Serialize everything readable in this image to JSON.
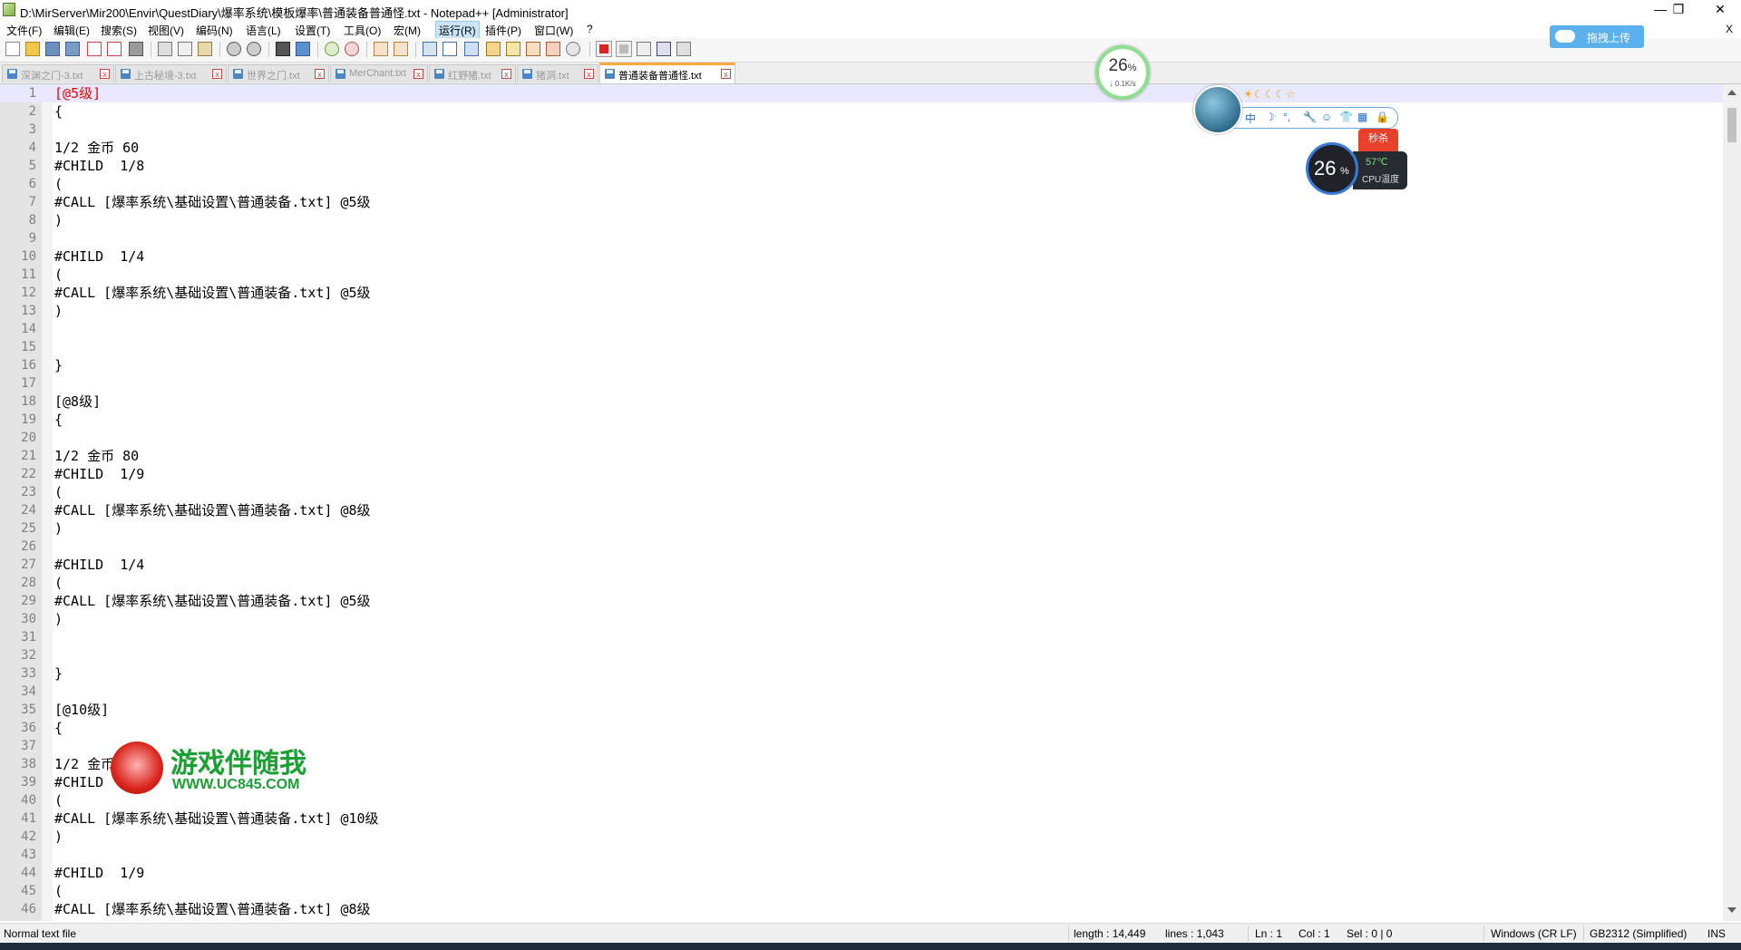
{
  "window": {
    "title": "D:\\MirServer\\Mir200\\Envir\\QuestDiary\\爆率系统\\模板爆率\\普通装备普通怪.txt - Notepad++ [Administrator]",
    "minimize": "—",
    "maximize": "❐",
    "close": "✕",
    "close2": "X"
  },
  "menu": [
    "文件(F)",
    "编辑(E)",
    "搜索(S)",
    "视图(V)",
    "编码(N)",
    "语言(L)",
    "设置(T)",
    "工具(O)",
    "宏(M)",
    "运行(R)",
    "插件(P)",
    "窗口(W)",
    "?"
  ],
  "tabs": [
    {
      "label": "深渊之门-3.txt"
    },
    {
      "label": "上古秘境-3.txt"
    },
    {
      "label": "世界之门.txt"
    },
    {
      "label": "MerChant.txt"
    },
    {
      "label": "红野猪.txt"
    },
    {
      "label": "猪洞.txt"
    },
    {
      "label": "普通装备普通怪.txt"
    }
  ],
  "editor": {
    "lines": [
      "[@5级]",
      "{",
      "",
      "1/2 金币 60",
      "#CHILD  1/8",
      "(",
      "#CALL [爆率系统\\基础设置\\普通装备.txt] @5级",
      ")",
      "",
      "#CHILD  1/4",
      "(",
      "#CALL [爆率系统\\基础设置\\普通装备.txt] @5级",
      ")",
      "",
      "",
      "}",
      "",
      "[@8级]",
      "{",
      "",
      "1/2 金币 80",
      "#CHILD  1/9",
      "(",
      "#CALL [爆率系统\\基础设置\\普通装备.txt] @8级",
      ")",
      "",
      "#CHILD  1/4",
      "(",
      "#CALL [爆率系统\\基础设置\\普通装备.txt] @5级",
      ")",
      "",
      "",
      "}",
      "",
      "[@10级]",
      "{",
      "",
      "1/2 金币",
      "#CHILD",
      "(",
      "#CALL [爆率系统\\基础设置\\普通装备.txt] @10级",
      ")",
      "",
      "#CHILD  1/9",
      "(",
      "#CALL [爆率系统\\基础设置\\普通装备.txt] @8级"
    ]
  },
  "status": {
    "type": "Normal text file",
    "length": "length : 14,449",
    "lines": "lines : 1,043",
    "ln": "Ln : 1",
    "col": "Col : 1",
    "sel": "Sel : 0 | 0",
    "eol": "Windows (CR LF)",
    "encoding": "GB2312 (Simplified)",
    "mode": "INS"
  },
  "overlays": {
    "net_percent": "26",
    "net_percent_unit": "%",
    "net_speed": "↓ 0.1K/s",
    "cloud_upload": "拖拽上传",
    "skin_suns": "☀☾☾☾☆",
    "skin_tools": [
      "中",
      "☽",
      "°,",
      "🔧",
      "☺",
      "👕",
      "▦",
      "🔒"
    ],
    "seckill": "秒杀",
    "cpu_percent": "26",
    "cpu_percent_unit": "%",
    "cpu_temp": "57℃",
    "cpu_label": "CPU温度",
    "watermark_title": "游戏伴随我",
    "watermark_url": "WWW.UC845.COM"
  },
  "colors": {
    "active_tab_accent": "#faaa3c",
    "current_line": "#e8e8ff",
    "section_header_red": "#e00000",
    "watermark_green": "#1aa033"
  }
}
